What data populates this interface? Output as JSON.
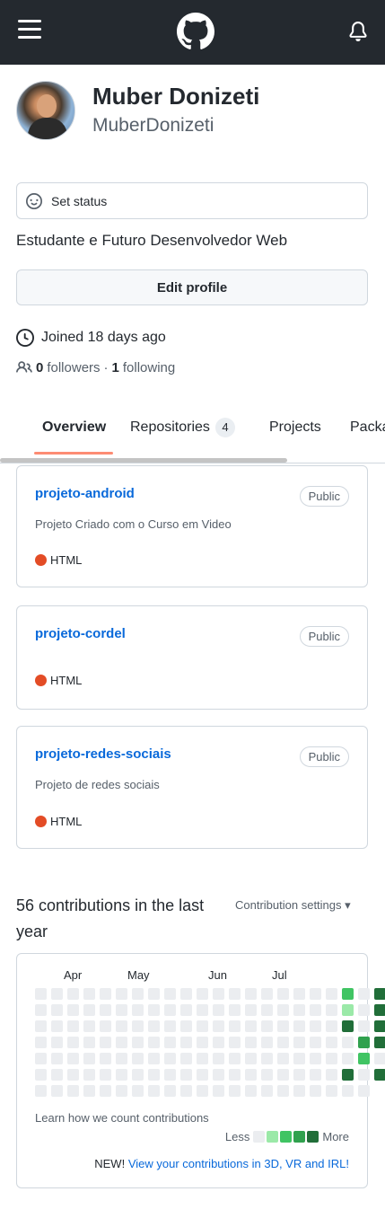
{
  "header": {
    "menu_icon": "hamburger-menu-icon",
    "logo_icon": "github-logo-icon",
    "notifications_icon": "bell-icon"
  },
  "profile": {
    "full_name": "Muber Donizeti",
    "username": "MuberDonizeti",
    "status_placeholder": "Set status",
    "bio": "Estudante e Futuro Desenvolvedor Web",
    "edit_profile_label": "Edit profile",
    "joined": "Joined 18 days ago",
    "followers_count": "0",
    "followers_label": "followers",
    "separator": "·",
    "following_count": "1",
    "following_label": "following"
  },
  "tabs": [
    {
      "label": "Overview",
      "active": true
    },
    {
      "label": "Repositories",
      "count": "4"
    },
    {
      "label": "Projects"
    },
    {
      "label": "Packages"
    }
  ],
  "repositories": [
    {
      "name": "projeto-android",
      "visibility": "Public",
      "description": "Projeto Criado com o Curso em Video",
      "language": "HTML",
      "language_color": "#e34c26"
    },
    {
      "name": "projeto-cordel",
      "visibility": "Public",
      "description": "",
      "language": "HTML",
      "language_color": "#e34c26"
    },
    {
      "name": "projeto-redes-sociais",
      "visibility": "Public",
      "description": "Projeto de redes sociais",
      "language": "HTML",
      "language_color": "#e34c26"
    }
  ],
  "contributions": {
    "title": "56 contributions in the last year",
    "settings_label": "Contribution settings ▾",
    "months": [
      "Apr",
      "May",
      "Jun",
      "Jul"
    ],
    "learn_link": "Learn how we count contributions",
    "legend_less": "Less",
    "legend_more": "More",
    "new_prefix": "NEW!",
    "new_link": "View your contributions in 3D, VR and IRL!",
    "colors": [
      "#ebedf0",
      "#9be9a8",
      "#40c463",
      "#30a14e",
      "#216e39"
    ],
    "grid_levels": [
      [
        0,
        0,
        0,
        0,
        0,
        0,
        0,
        0,
        0,
        0,
        0,
        0,
        0,
        0,
        0,
        0,
        0,
        0,
        0,
        2,
        0,
        4
      ],
      [
        0,
        0,
        0,
        0,
        0,
        0,
        0,
        0,
        0,
        0,
        0,
        0,
        0,
        0,
        0,
        0,
        0,
        0,
        0,
        1,
        0,
        4
      ],
      [
        0,
        0,
        0,
        0,
        0,
        0,
        0,
        0,
        0,
        0,
        0,
        0,
        0,
        0,
        0,
        0,
        0,
        0,
        0,
        4,
        0,
        4
      ],
      [
        0,
        0,
        0,
        0,
        0,
        0,
        0,
        0,
        0,
        0,
        0,
        0,
        0,
        0,
        0,
        0,
        0,
        0,
        0,
        0,
        3,
        4
      ],
      [
        0,
        0,
        0,
        0,
        0,
        0,
        0,
        0,
        0,
        0,
        0,
        0,
        0,
        0,
        0,
        0,
        0,
        0,
        0,
        0,
        2,
        0
      ],
      [
        0,
        0,
        0,
        0,
        0,
        0,
        0,
        0,
        0,
        0,
        0,
        0,
        0,
        0,
        0,
        0,
        0,
        0,
        0,
        4,
        0,
        4
      ],
      [
        0,
        0,
        0,
        0,
        0,
        0,
        0,
        0,
        0,
        0,
        0,
        0,
        0,
        0,
        0,
        0,
        0,
        0,
        0,
        0,
        0,
        null
      ]
    ]
  }
}
